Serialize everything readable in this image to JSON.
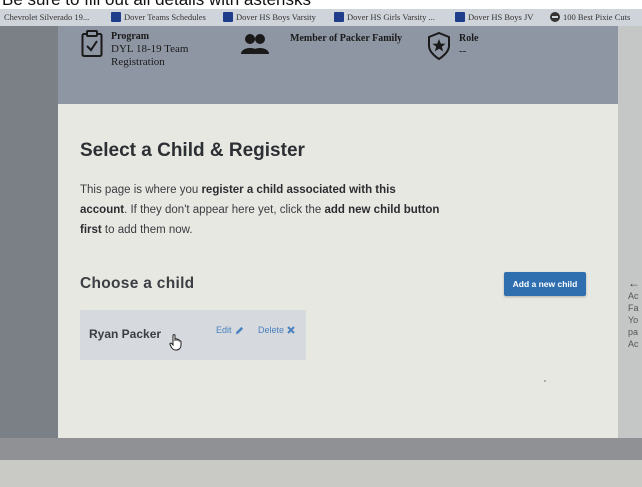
{
  "caption": "Be sure to fill out all details with asterisks",
  "bookmarks": [
    {
      "label": "Chevrolet Silverado 19..."
    },
    {
      "label": "Dover Teams Schedules"
    },
    {
      "label": "Dover HS Boys Varsity"
    },
    {
      "label": "Dover HS Girls Varsity ..."
    },
    {
      "label": "Dover HS Boys JV"
    },
    {
      "label": "100 Best Pixie Cuts"
    }
  ],
  "header": {
    "program_label": "Program",
    "program_value": "DYL 18-19 Team Registration",
    "family_label": "Member of Packer Family",
    "role_label": "Role",
    "role_value": "--"
  },
  "main": {
    "title": "Select a Child & Register",
    "desc_1": "This page is where you ",
    "desc_2": "register a child associated with this account",
    "desc_3": ". If they don't appear here yet, click the ",
    "desc_4": "add new child button first",
    "desc_5": " to add them now.",
    "choose_heading": "Choose a child",
    "add_button": "Add a new child",
    "child": {
      "name": "Ryan Packer",
      "edit": "Edit",
      "delete": "Delete"
    }
  },
  "side_panel": {
    "lines": [
      "Ac",
      "Fa",
      "Yo",
      "pa",
      "Ac"
    ]
  },
  "colors": {
    "header_band": "#8e96a3",
    "content_bg": "#e8e8e3",
    "button_blue": "#2f6fb0",
    "link_blue": "#4a82c0"
  }
}
